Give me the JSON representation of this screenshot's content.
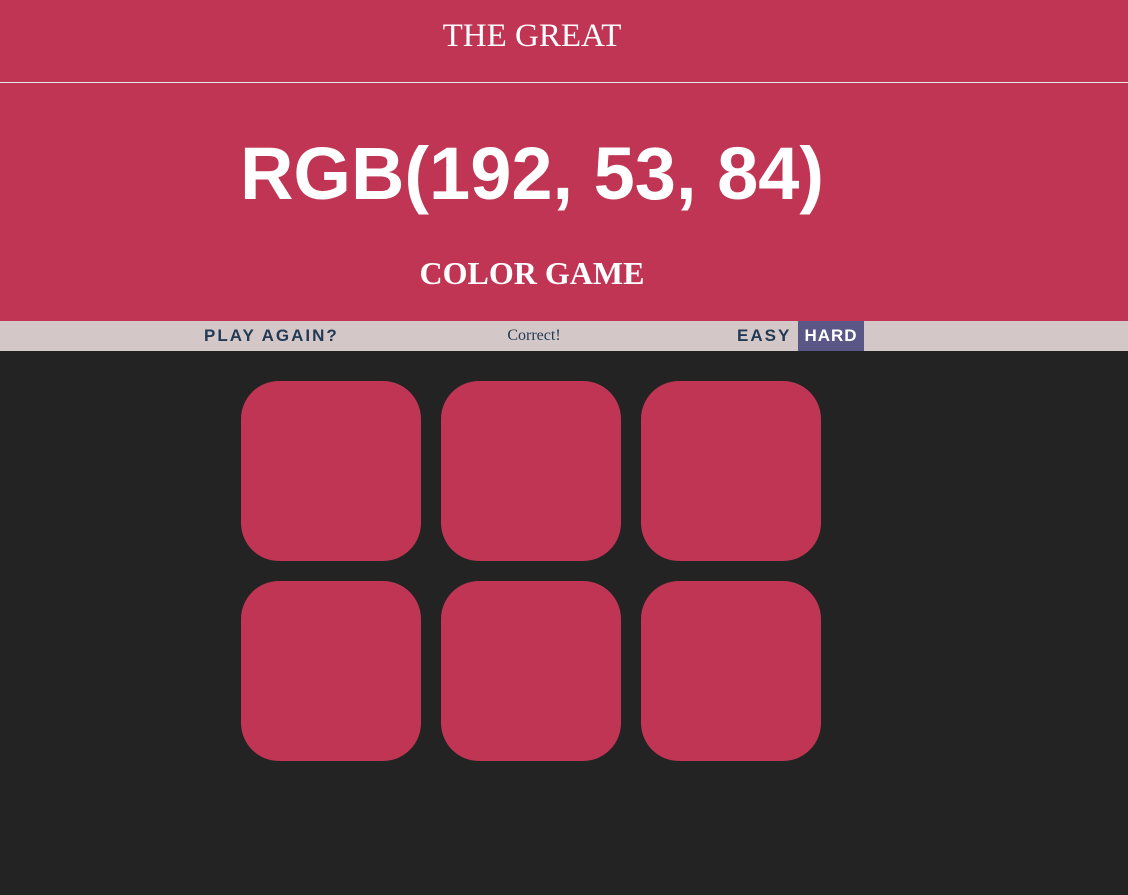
{
  "header": {
    "title_top": "THE GREAT",
    "rgb_display": "RGB(192, 53, 84)",
    "title_bottom": "COLOR GAME"
  },
  "controls": {
    "reset_label": "PLAY AGAIN?",
    "message": "Correct!",
    "easy_label": "EASY",
    "hard_label": "HARD",
    "selected_mode": "HARD"
  },
  "colors": {
    "header_bg": "#c03554",
    "stripe_bg": "#d3c7c7",
    "body_bg": "#232323",
    "selected_btn_bg": "#5a5786",
    "text_dark": "#233a54"
  },
  "squares": [
    {
      "color": "#c03554"
    },
    {
      "color": "#c03554"
    },
    {
      "color": "#c03554"
    },
    {
      "color": "#c03554"
    },
    {
      "color": "#c03554"
    },
    {
      "color": "#c03554"
    }
  ]
}
